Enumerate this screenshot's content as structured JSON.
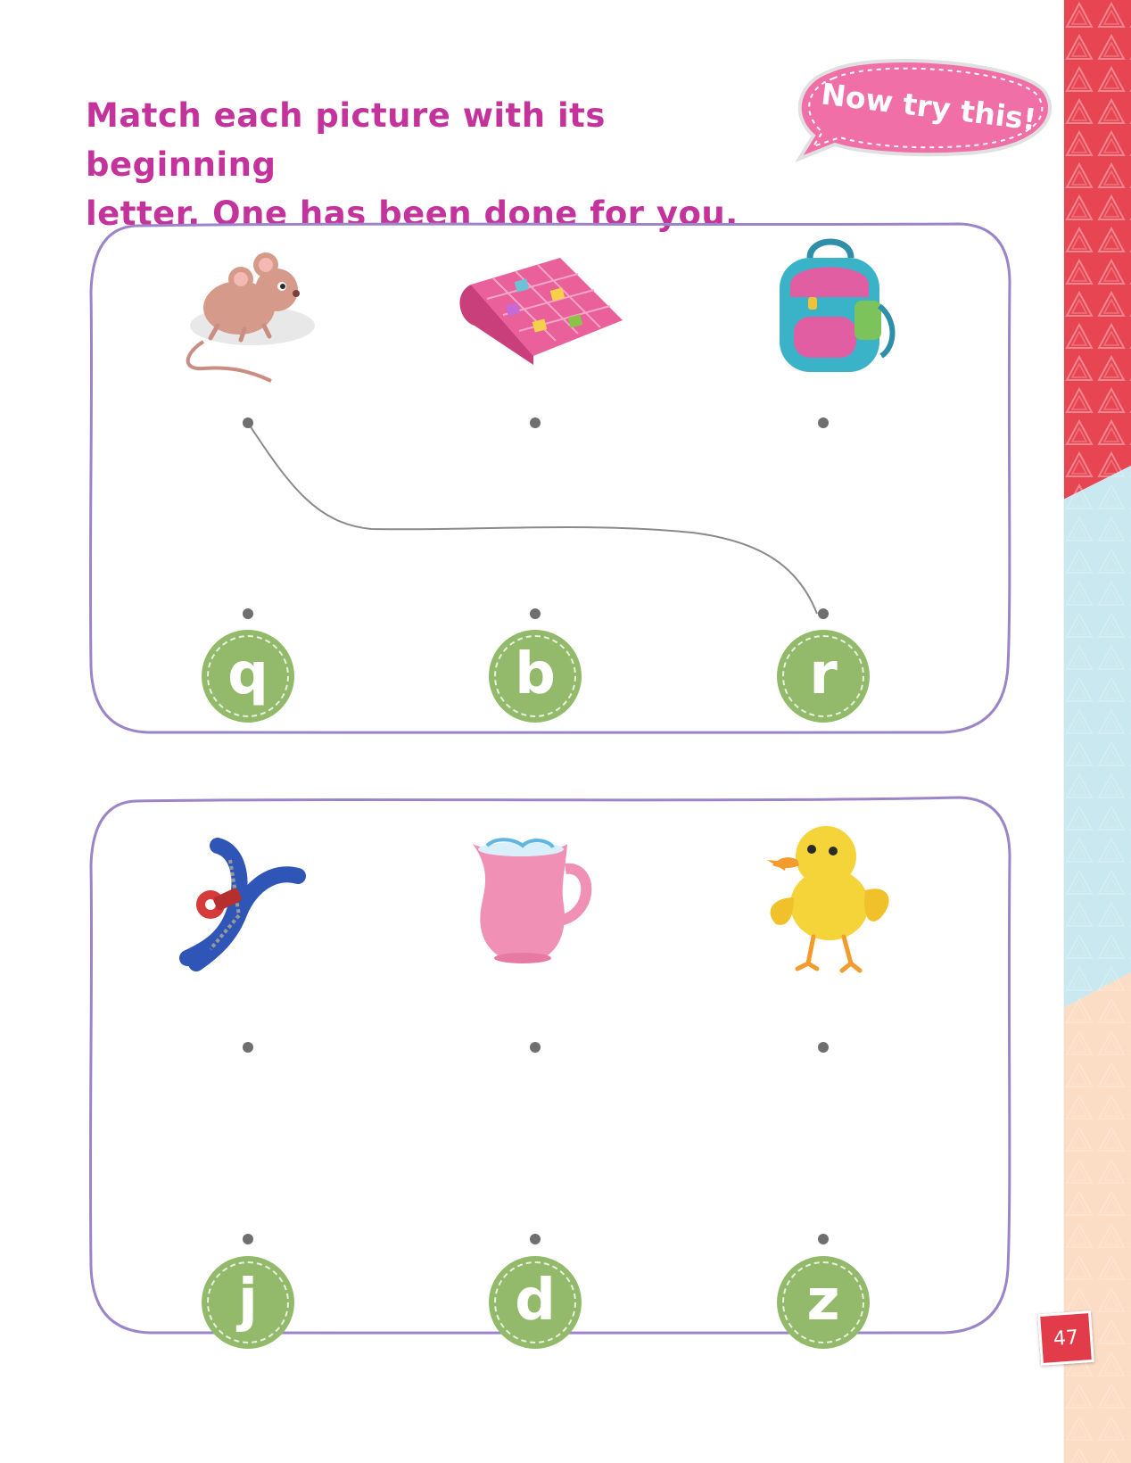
{
  "instruction": {
    "line1": "Match each picture with its beginning",
    "line2": "letter. One has been done for you."
  },
  "badge": {
    "text": "Now try this!"
  },
  "exercise_1": {
    "pictures": [
      {
        "icon": "mouse-illustration"
      },
      {
        "icon": "quilt-illustration"
      },
      {
        "icon": "backpack-illustration"
      }
    ],
    "letters": [
      "q",
      "b",
      "r"
    ],
    "example_match": {
      "picture": "mouse",
      "letter": "r"
    }
  },
  "exercise_2": {
    "pictures": [
      {
        "icon": "zipper-illustration"
      },
      {
        "icon": "jug-illustration"
      },
      {
        "icon": "duck-illustration"
      }
    ],
    "letters": [
      "j",
      "d",
      "z"
    ]
  },
  "page_number": "47",
  "colors": {
    "heading": "#c4339b",
    "letter_circle": "#93ba6a",
    "frame": "#9b85c8",
    "bubble": "#ef6fa6"
  }
}
